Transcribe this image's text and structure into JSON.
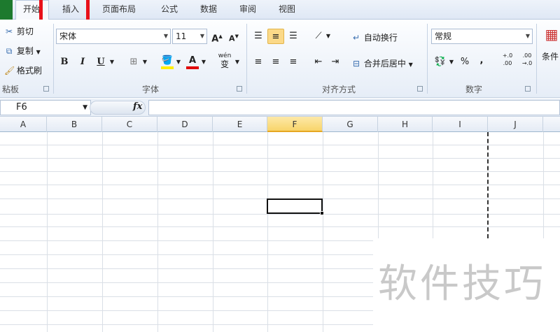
{
  "tabs": {
    "home": "开始",
    "insert": "插入",
    "page_layout": "页面布局",
    "formulas": "公式",
    "data": "数据",
    "review": "审阅",
    "view": "视图"
  },
  "clipboard": {
    "cut": "剪切",
    "copy": "复制",
    "format_painter": "格式刷",
    "label": "粘板"
  },
  "font": {
    "name": "宋体",
    "size": "11",
    "bold": "B",
    "italic": "I",
    "underline": "U",
    "font_color": "A",
    "phonetic": "wén",
    "label": "字体"
  },
  "alignment": {
    "wrap_text": "自动换行",
    "merge_center": "合并后居中",
    "label": "对齐方式"
  },
  "number": {
    "format": "常规",
    "percent": "%",
    "comma": ",",
    "increase_decimal": "+.0 .00",
    "decrease_decimal": ".00 →.0",
    "label": "数字"
  },
  "styles": {
    "conditional": "条件"
  },
  "formula_bar": {
    "cell_ref": "F6",
    "fx": "fx"
  },
  "columns": [
    "A",
    "B",
    "C",
    "D",
    "E",
    "F",
    "G",
    "H",
    "I",
    "J"
  ],
  "selected_column": "F",
  "watermark": "软件技巧",
  "colors": {
    "highlight": "#e8111a",
    "selected_header": "#f8d46a",
    "fill_color": "#ffee00",
    "font_color": "#e00000"
  }
}
